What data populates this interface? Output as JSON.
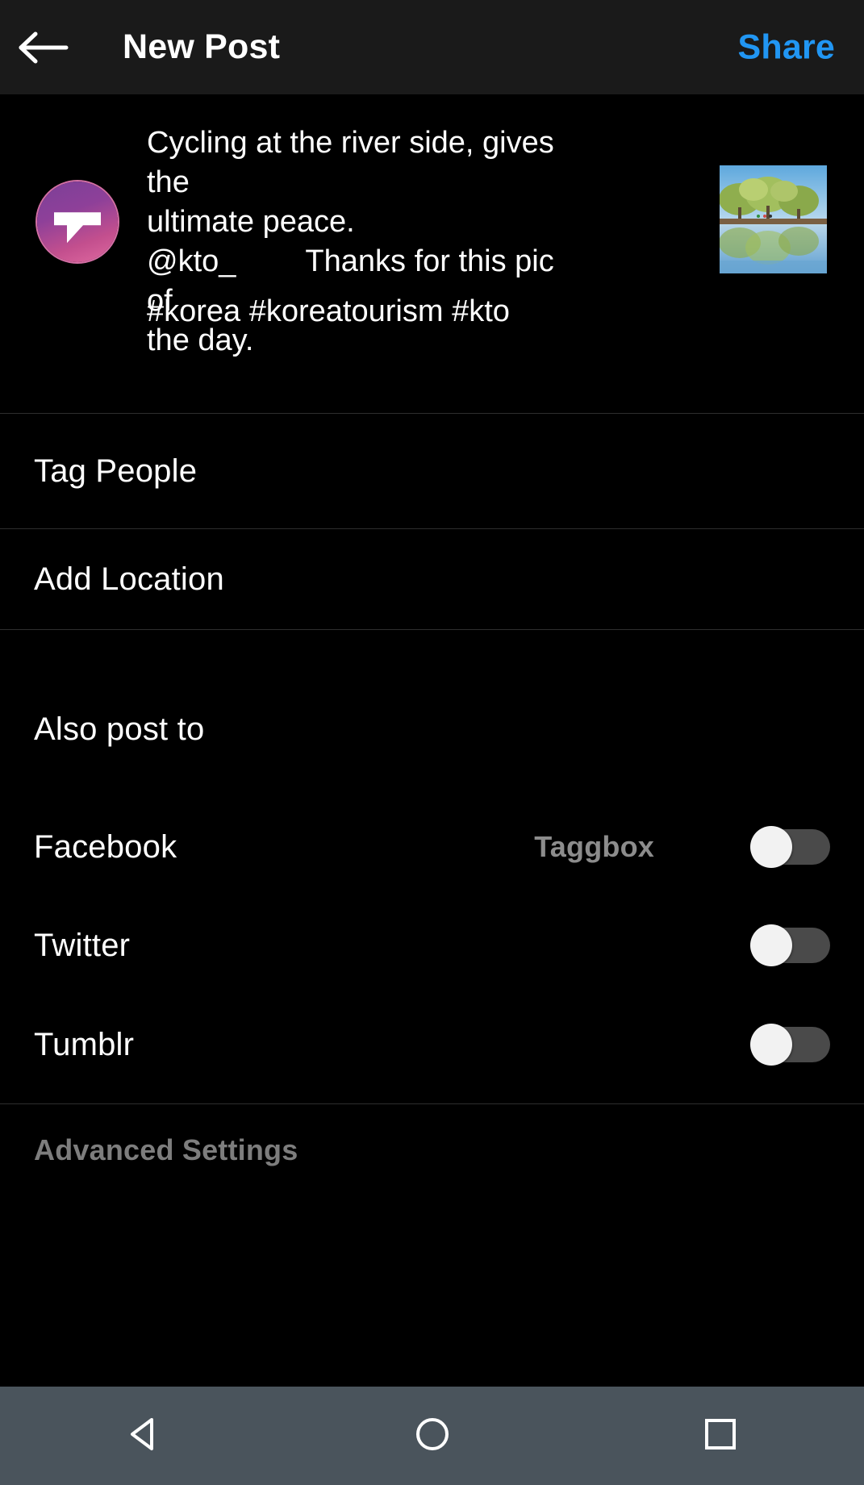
{
  "header": {
    "back_icon": "arrow-left-icon",
    "title": "New Post",
    "share_label": "Share",
    "share_color": "#2196f3",
    "background": "#1a1a1a"
  },
  "composer": {
    "avatar_icon": "taggbox-avatar",
    "caption_line1": "Cycling at the river side, gives the",
    "caption_line2": "ultimate peace.",
    "caption_mention": "@kto_",
    "caption_line3": "Thanks for this pic of",
    "caption_line4": "the day.",
    "hashtags": "#korea #koreatourism #kto",
    "thumbnail_alt": "riverside trees reflected in water"
  },
  "menu": {
    "items": [
      {
        "label": "Tag People",
        "name": "tag-people"
      },
      {
        "label": "Add Location",
        "name": "add-location"
      }
    ]
  },
  "also_post_to": {
    "title": "Also post to",
    "services": [
      {
        "label": "Facebook",
        "account": "Taggbox",
        "enabled": false
      },
      {
        "label": "Twitter",
        "account": "",
        "enabled": false
      },
      {
        "label": "Tumblr",
        "account": "",
        "enabled": false
      }
    ]
  },
  "advanced": {
    "label": "Advanced Settings"
  },
  "navbar": {
    "back_icon": "triangle-back-icon",
    "home_icon": "circle-home-icon",
    "recents_icon": "square-recents-icon",
    "background": "#4a545c"
  }
}
